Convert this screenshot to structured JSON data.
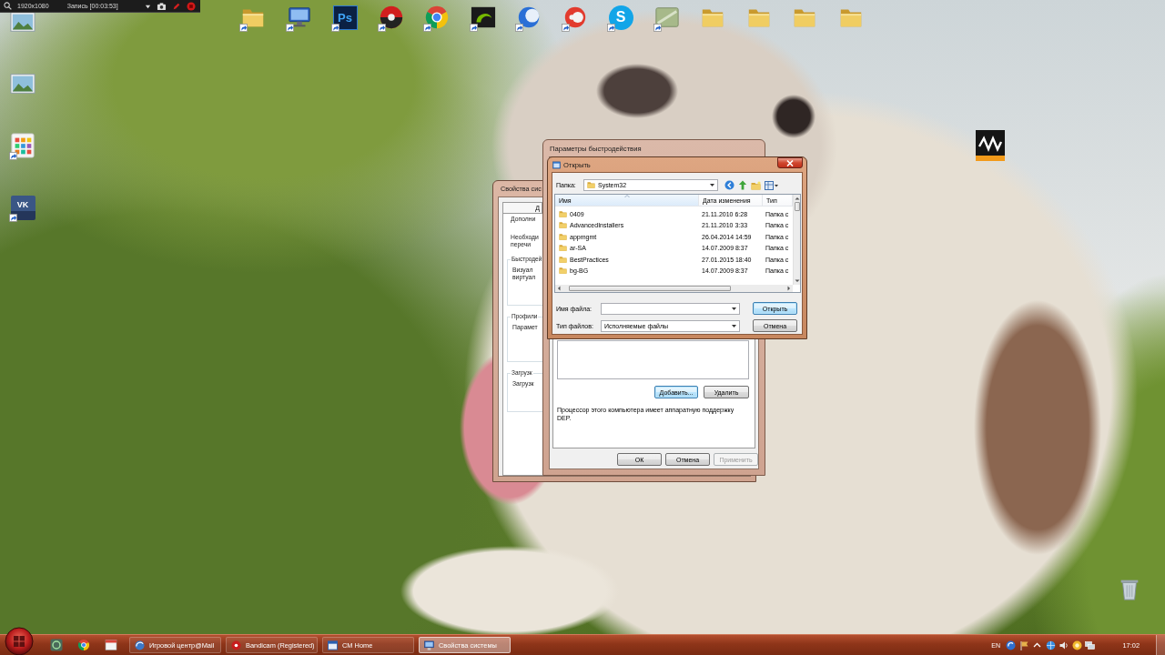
{
  "record_bar": {
    "resolution": "1920x1080",
    "status": "Запись [00:03:53]"
  },
  "desktop_icons": {
    "left": [
      {
        "kind": "photo",
        "shortcut": false
      },
      {
        "kind": "photo",
        "shortcut": false
      },
      {
        "kind": "grid",
        "shortcut": true
      },
      {
        "kind": "plate",
        "text": "VK",
        "shortcut": true
      }
    ],
    "top": [
      {
        "kind": "folder",
        "shortcut": true
      },
      {
        "kind": "monitor",
        "shortcut": true
      },
      {
        "kind": "tile",
        "text": "Ps",
        "shortcut": true
      },
      {
        "kind": "disc",
        "shortcut": true
      },
      {
        "kind": "wheel",
        "shortcut": true
      },
      {
        "kind": "swirl",
        "shortcut": true
      },
      {
        "kind": "crescent",
        "shortcut": true
      },
      {
        "kind": "twin",
        "shortcut": true
      },
      {
        "kind": "bubble",
        "text": "S",
        "shortcut": true
      },
      {
        "kind": "card",
        "shortcut": true
      },
      {
        "kind": "folder",
        "shortcut": false
      },
      {
        "kind": "folder",
        "shortcut": false
      },
      {
        "kind": "folder",
        "shortcut": false
      },
      {
        "kind": "folder",
        "shortcut": false
      }
    ],
    "right": [
      {
        "kind": "wave",
        "shortcut": false
      }
    ],
    "corner": [
      {
        "kind": "bin",
        "shortcut": false
      }
    ]
  },
  "system_properties": {
    "title": "Свойства сис",
    "tabs": [
      {
        "label": "Д",
        "selected": true
      }
    ],
    "sections": [
      {
        "lines": [
          "Дополни"
        ]
      },
      {
        "lines": [
          "Необходи",
          "перечи"
        ]
      },
      {
        "heading": "Быстродей",
        "lines": [
          "Визуал",
          "виртуал"
        ]
      },
      {
        "heading": "Профили",
        "lines": [
          "Парамет"
        ]
      },
      {
        "heading": "Загрузк",
        "lines": [
          "Загрузк"
        ]
      }
    ]
  },
  "performance_options": {
    "title": "Параметры быстродействия",
    "list_buttons": [
      {
        "label": "Добавить...",
        "focused": true
      },
      {
        "label": "Удалить",
        "focused": false
      }
    ],
    "note": "Процессор этого компьютера имеет аппаратную поддержку DEP.",
    "buttons": [
      {
        "label": "ОК",
        "disabled": false
      },
      {
        "label": "Отмена",
        "disabled": false
      },
      {
        "label": "Применить",
        "disabled": true
      }
    ]
  },
  "open_dialog": {
    "title": "Открыть",
    "folder_label": "Папка:",
    "folder": "System32",
    "columns": [
      {
        "label": "Имя",
        "sorted": true
      },
      {
        "label": "Дата изменения",
        "sorted": false
      },
      {
        "label": "Тип",
        "sorted": false
      }
    ],
    "rows": [
      {
        "name": "0409",
        "modified": "21.11.2010 6:28",
        "type": "Папка с"
      },
      {
        "name": "AdvancedInstallers",
        "modified": "21.11.2010 3:33",
        "type": "Папка с"
      },
      {
        "name": "appmgmt",
        "modified": "26.04.2014 14:59",
        "type": "Папка с"
      },
      {
        "name": "ar-SA",
        "modified": "14.07.2009 8:37",
        "type": "Папка с"
      },
      {
        "name": "BestPractices",
        "modified": "27.01.2015 18:40",
        "type": "Папка с"
      },
      {
        "name": "bg-BG",
        "modified": "14.07.2009 8:37",
        "type": "Папка с"
      }
    ],
    "file_name_label": "Имя файла:",
    "file_type_label": "Тип файлов:",
    "file_type": "Исполняемые файлы",
    "buttons": [
      {
        "label": "Открыть",
        "default": true
      },
      {
        "label": "Отмена",
        "default": false
      }
    ]
  },
  "taskbar": {
    "tasks": [
      {
        "label": "Игровой центр@Mail",
        "selected": false
      },
      {
        "label": "Bandicam (Registered)",
        "selected": false
      },
      {
        "label": "CM Home",
        "selected": false
      },
      {
        "label": "Свойства системы",
        "selected": true
      }
    ],
    "language": "EN",
    "clock": "17:02"
  }
}
